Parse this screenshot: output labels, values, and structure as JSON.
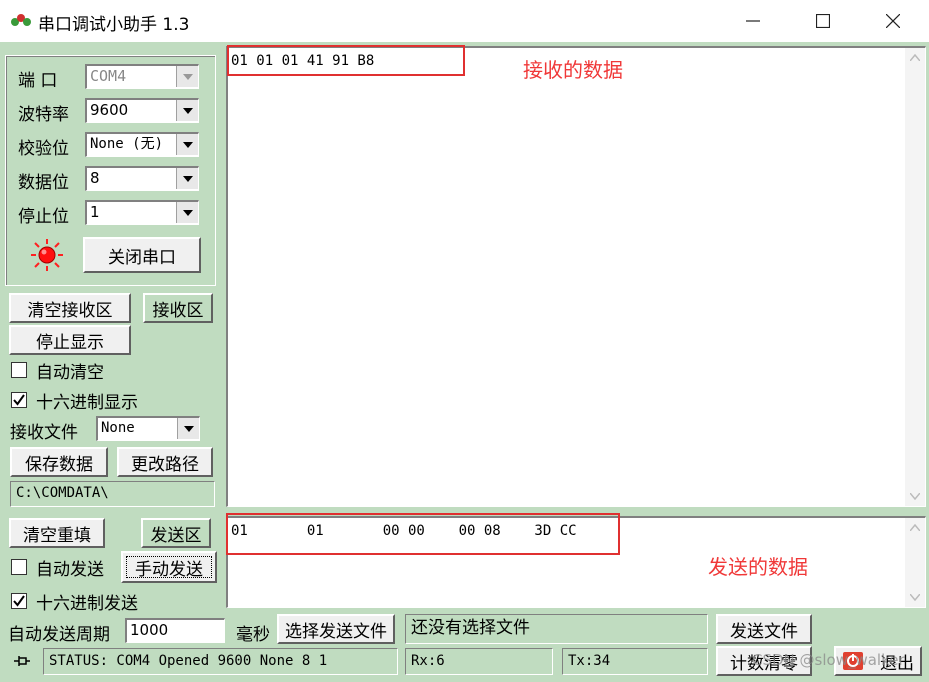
{
  "window": {
    "title": "串口调试小助手 1.3",
    "minimize": "—",
    "maximize": "☐",
    "close": "✕"
  },
  "port_settings": {
    "port_label": "端 口",
    "port_value": "COM4",
    "baud_label": "波特率",
    "baud_value": "9600",
    "parity_label": "校验位",
    "parity_value": "None (无)",
    "databits_label": "数据位",
    "databits_value": "8",
    "stopbits_label": "停止位",
    "stopbits_value": "1",
    "close_port_label": "关闭串口",
    "status_led_color": "#ff1010"
  },
  "receive_panel": {
    "clear_label": "清空接收区",
    "area_label": "接收区",
    "stop_display_label": "停止显示",
    "auto_clear_label": "自动清空",
    "auto_clear_checked": false,
    "hex_display_label": "十六进制显示",
    "hex_display_checked": true,
    "file_label": "接收文件",
    "file_value": "None",
    "save_label": "保存数据",
    "change_path_label": "更改路径",
    "path_value": "C:\\COMDATA\\",
    "content": "01 01 01 41 91 B8"
  },
  "send_panel": {
    "clear_label": "清空重填",
    "area_label": "发送区",
    "auto_send_label": "自动发送",
    "auto_send_checked": false,
    "manual_send_label": "手动发送",
    "hex_send_label": "十六进制发送",
    "hex_send_checked": true,
    "period_label": "自动发送周期",
    "period_value": "1000",
    "ms_label": "毫秒",
    "select_file_label": "选择发送文件",
    "file_status": "还没有选择文件",
    "send_file_label": "发送文件",
    "content": "01       01       00 00    00 08    3D CC"
  },
  "status_bar": {
    "status_text": "STATUS: COM4 Opened 9600 None  8 1",
    "rx": "Rx:6",
    "tx": "Tx:34",
    "reset_count_label": "计数清零",
    "exit_label": "退出"
  },
  "annotations": {
    "received_label": "接收的数据",
    "sent_label": "发送的数据",
    "color": "#e03030"
  },
  "watermark": "CSDN @slow_walker"
}
